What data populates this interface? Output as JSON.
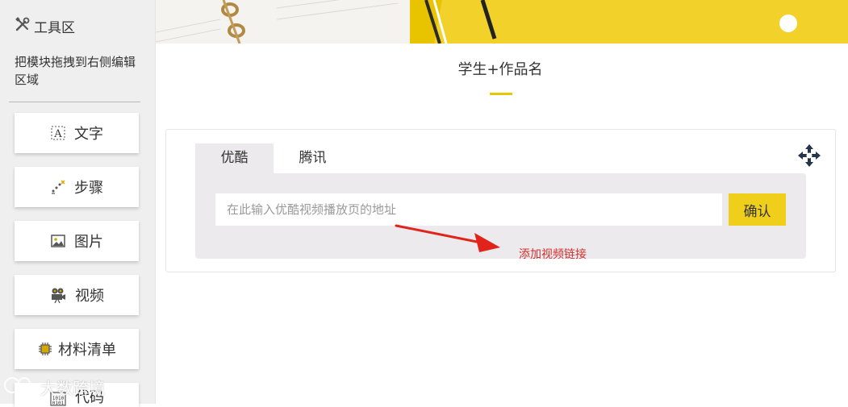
{
  "sidebar": {
    "title": "工具区",
    "description": "把模块拖拽到右侧编辑区域",
    "items": [
      {
        "label": "文字",
        "icon": "text-icon"
      },
      {
        "label": "步骤",
        "icon": "steps-icon"
      },
      {
        "label": "图片",
        "icon": "image-icon"
      },
      {
        "label": "视频",
        "icon": "video-camera-icon"
      },
      {
        "label": "材料清单",
        "icon": "chip-icon"
      },
      {
        "label": "代码",
        "icon": "code-icon"
      }
    ]
  },
  "main": {
    "title": "学生+作品名",
    "video_panel": {
      "tabs": [
        {
          "label": "优酷",
          "active": true
        },
        {
          "label": "腾讯",
          "active": false
        }
      ],
      "input_value": "",
      "input_placeholder": "在此输入优酷视频播放页的地址",
      "confirm_label": "确认",
      "annotation": "添加视频链接"
    }
  },
  "watermark": "大数跨境",
  "colors": {
    "accent": "#f0cf1c",
    "sidebar_bg": "#efefef",
    "annotation": "#d12f2f"
  }
}
